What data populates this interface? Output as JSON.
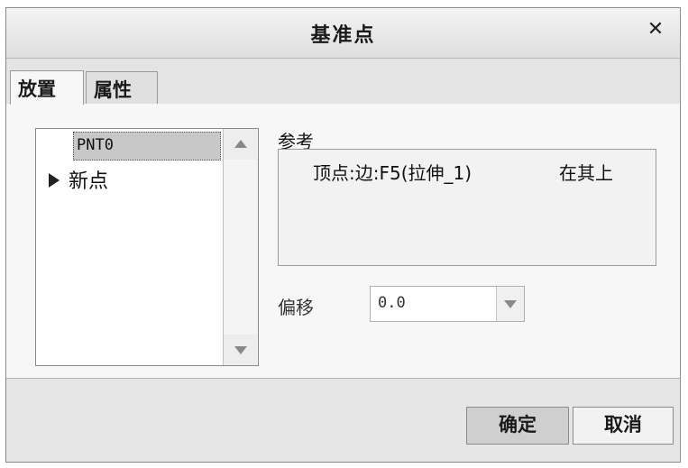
{
  "dialog": {
    "title": "基准点",
    "close_glyph": "✕"
  },
  "tabs": [
    {
      "label": "放置"
    },
    {
      "label": "属性"
    }
  ],
  "point_list": {
    "items": [
      {
        "label": "PNT0"
      },
      {
        "label": "新点"
      }
    ]
  },
  "references": {
    "label": "参考",
    "entries": [
      {
        "reference": "顶点:边:F5(拉伸_1)",
        "type": "在其上"
      }
    ]
  },
  "offset": {
    "label": "偏移",
    "value": "0.0"
  },
  "buttons": {
    "ok": "确定",
    "cancel": "取消"
  }
}
